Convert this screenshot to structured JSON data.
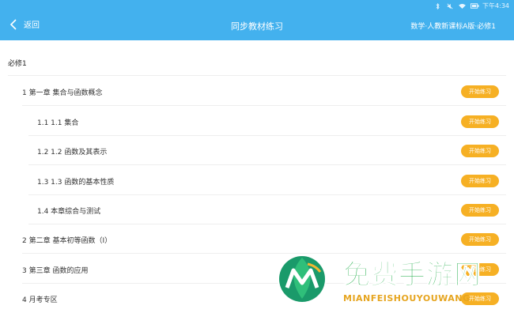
{
  "status_bar": {
    "time": "下午4:34"
  },
  "header": {
    "back_label": "返回",
    "title": "同步教材练习",
    "subject": "数学·人教新课标A版·必修1"
  },
  "section": {
    "title": "必修1"
  },
  "rows": [
    {
      "level": "chapter",
      "label": "1  第一章 集合与函数概念",
      "button": "开始练习"
    },
    {
      "level": "sub",
      "label": "1.1  1.1 集合",
      "button": "开始练习"
    },
    {
      "level": "sub",
      "label": "1.2  1.2 函数及其表示",
      "button": "开始练习"
    },
    {
      "level": "sub",
      "label": "1.3  1.3 函数的基本性质",
      "button": "开始练习"
    },
    {
      "level": "sub",
      "label": "1.4  本章综合与测试",
      "button": "开始练习"
    },
    {
      "level": "chapter",
      "label": "2  第二章 基本初等函数（I）",
      "button": "开始练习"
    },
    {
      "level": "chapter",
      "label": "3  第三章 函数的应用",
      "button": "开始练习"
    },
    {
      "level": "chapter",
      "label": "4  月考专区",
      "button": "开始练习"
    }
  ],
  "watermark": {
    "title": "免费手游网",
    "domain": "MIANFEISHOUYOUWANG"
  },
  "colors": {
    "header": "#43b1ee",
    "button": "#f6b024",
    "watermark_green": "#13a83e",
    "watermark_orange": "#e6a520"
  }
}
